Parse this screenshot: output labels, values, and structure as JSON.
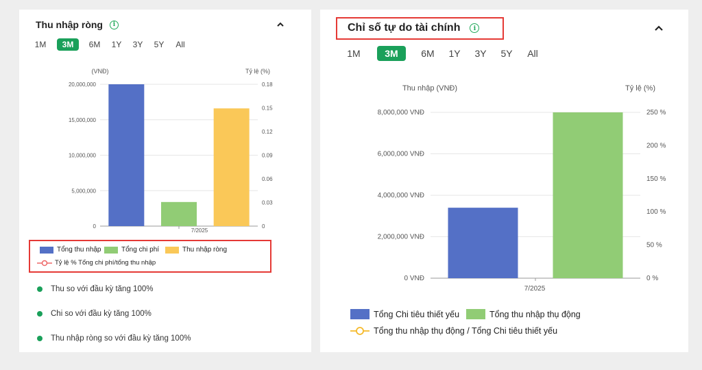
{
  "left": {
    "title": "Thu nhập ròng",
    "tabs": [
      "1M",
      "3M",
      "6M",
      "1Y",
      "3Y",
      "5Y",
      "All"
    ],
    "active_tab": 1,
    "left_axis_unit": "(VNĐ)",
    "right_axis_unit": "Tỷ lệ (%)",
    "left_ticks": [
      "20,000,000",
      "15,000,000",
      "10,000,000",
      "5,000,000",
      "0"
    ],
    "right_ticks": [
      "0.18",
      "0.15",
      "0.12",
      "0.09",
      "0.06",
      "0.03",
      "0"
    ],
    "x_label": "7/2025",
    "legend": [
      "Tổng thu nhập",
      "Tổng chi phí",
      "Thu nhập ròng",
      "Tỷ lệ % Tổng chi phí/tổng thu nhập"
    ],
    "bullets": [
      "Thu so với đầu kỳ tăng 100%",
      "Chi so với đầu kỳ tăng 100%",
      "Thu nhập ròng so với đầu kỳ tăng 100%"
    ]
  },
  "right": {
    "title": "Chỉ số tự do tài chính",
    "tabs": [
      "1M",
      "3M",
      "6M",
      "1Y",
      "3Y",
      "5Y",
      "All"
    ],
    "active_tab": 1,
    "left_axis_unit": "Thu nhập (VNĐ)",
    "right_axis_unit": "Tỷ lệ (%)",
    "left_ticks": [
      "8,000,000 VNĐ",
      "6,000,000 VNĐ",
      "4,000,000 VNĐ",
      "2,000,000 VNĐ",
      "0 VNĐ"
    ],
    "right_ticks": [
      "250 %",
      "200 %",
      "150 %",
      "100 %",
      "50 %",
      "0 %"
    ],
    "x_label": "7/2025",
    "legend": [
      "Tổng Chi tiêu thiết yếu",
      "Tổng thu nhập thụ động",
      "Tổng thu nhập thụ động / Tổng Chi tiêu thiết yếu"
    ]
  },
  "colors": {
    "blue": "#5470c6",
    "green": "#91cc75",
    "yellow": "#fac858",
    "red": "#ee6666",
    "orange": "#f5b92a",
    "accent": "#1aa05a",
    "highlight": "#e53935"
  },
  "chart_data": [
    {
      "type": "bar",
      "categories": [
        "7/2025"
      ],
      "ylabel": "(VNĐ)",
      "y2label": "Tỷ lệ (%)",
      "ylim": [
        0,
        20000000
      ],
      "y2lim": [
        0,
        0.18
      ],
      "series": [
        {
          "name": "Tổng thu nhập",
          "values": [
            20000000
          ]
        },
        {
          "name": "Tổng chi phí",
          "values": [
            3400000
          ]
        },
        {
          "name": "Thu nhập ròng",
          "values": [
            16600000
          ]
        },
        {
          "name": "Tỷ lệ % Tổng chi phí/tổng thu nhập",
          "type": "line",
          "values": []
        }
      ]
    },
    {
      "type": "bar",
      "categories": [
        "7/2025"
      ],
      "ylabel": "Thu nhập (VNĐ)",
      "y2label": "Tỷ lệ (%)",
      "ylim": [
        0,
        8000000
      ],
      "y2lim": [
        0,
        250
      ],
      "series": [
        {
          "name": "Tổng Chi tiêu thiết yếu",
          "values": [
            3400000
          ]
        },
        {
          "name": "Tổng thu nhập thụ động",
          "values": [
            8000000
          ]
        },
        {
          "name": "Tổng thu nhập thụ động / Tổng Chi tiêu thiết yếu",
          "type": "line",
          "values": []
        }
      ]
    }
  ]
}
